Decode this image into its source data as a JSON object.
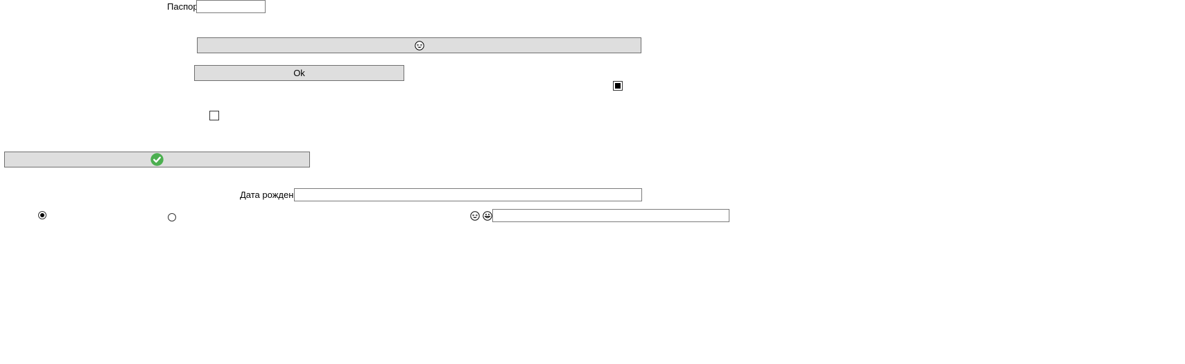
{
  "form": {
    "passport": {
      "label": "Паспорт",
      "value": ""
    },
    "emoji_button": {
      "icon": "grinning-squint-emoji-icon"
    },
    "ok_button": {
      "label": "Ok"
    },
    "checkbox_right": {
      "state": "indeterminate"
    },
    "checkbox_left": {
      "state": "unchecked"
    },
    "confirm_button": {
      "icon": "green-check-circle-icon",
      "icon_color": "#4caf50"
    },
    "birth_date": {
      "label": "Дата рождения",
      "value": ""
    },
    "radio_1": {
      "checked": true
    },
    "radio_2": {
      "checked": false
    },
    "emoji_input": {
      "icons": [
        "laughing-emoji-icon",
        "grinning-emoji-icon"
      ],
      "value": ""
    }
  },
  "colors": {
    "button_bg": "#dedede",
    "button_border": "#6f6f6f",
    "input_border": "#7a7a7a",
    "check_green": "#4caf50"
  }
}
